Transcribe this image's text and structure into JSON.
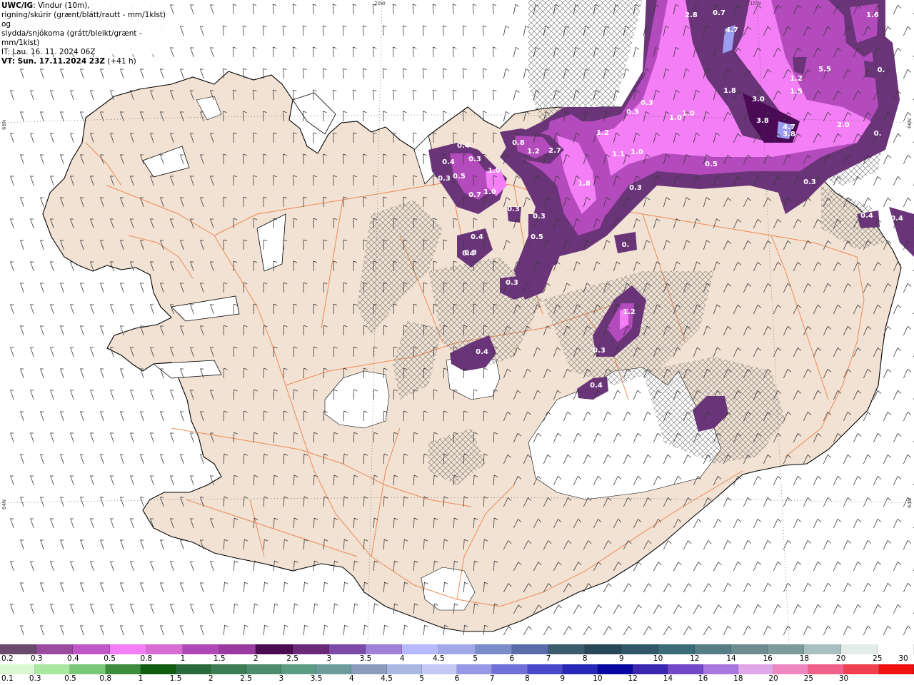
{
  "header": {
    "model": "UWC/IG",
    "line1_rest": ": Vindur (10m),",
    "line2": "rigning/skúrir (grænt/blátt/rautt - mm/1klst) og",
    "line3": "slydda/snjókoma (grátt/bleikt/grænt - mm/1klst)",
    "line4": "IT: Lau. 16. 11. 2024 06Z",
    "line5_bold": "VT: Sun. 17.11.2024 23Z",
    "line5_rest": " (+41 h)"
  },
  "graticule": {
    "top_20w": "20W",
    "top_15w": "15W",
    "left_66n": "66N",
    "right_66n": "66N",
    "left_64n": "64N",
    "right_64n": "64N"
  },
  "map_labels": [
    "0.4",
    "0.4",
    "0.3",
    "0.5",
    "0.3",
    "0.7",
    "1.0",
    "1.0",
    "0.3",
    "0.4",
    "0.4",
    "0.3",
    "0.5",
    "0.3",
    "0.8",
    "1.2",
    "2.7",
    "1.8",
    "1.2",
    "1.1",
    "1.0",
    "0.3",
    "0.3",
    "0.3",
    "1.0",
    "1.0",
    "0.5",
    "2.8",
    "0.7",
    "4.7",
    "1.8",
    "3.0",
    "3.8",
    "3.8",
    "4.7",
    "2.0",
    "0.",
    "1.6",
    "5.5",
    "1.5",
    "1.2",
    "0.",
    "0.4",
    "0.4",
    "0.3",
    "1.2",
    "0.3",
    "0.4",
    "0.4",
    "0.3",
    "0."
  ],
  "colors": {
    "land": "#f1e2d4",
    "sea": "#ffffff",
    "roads": "#ee7b3c",
    "coast": "#000000",
    "snow_dark": "#6a3478",
    "snow_mid": "#b44bbd",
    "snow_light": "#f47ef5",
    "snow_deep": "#4a0a55",
    "snow_blue": "#9c9cf0"
  },
  "legend_snow": {
    "colors": [
      "#6c4a6e",
      "#9c4aa0",
      "#c058c8",
      "#f47ef5",
      "#d76cd5",
      "#b048b8",
      "#9a3aa0",
      "#4c0a50",
      "#6a2a78",
      "#7c4ca8",
      "#a080d8",
      "#b8b8ff",
      "#a0a8e8",
      "#7c8cc8",
      "#5c6ca8",
      "#3c5c6c",
      "#284858",
      "#305868",
      "#3c6c78",
      "#587c84",
      "#6c8c90",
      "#7c9c9c",
      "#a8c0c0",
      "#e4ecea",
      "#ffffff"
    ],
    "labels": [
      "0.2",
      "0.3",
      "0.4",
      "0.5",
      "0.8",
      "1",
      "1.5",
      "2",
      "2.5",
      "3",
      "3.5",
      "4",
      "4.5",
      "5",
      "6",
      "7",
      "8",
      "9",
      "10",
      "12",
      "14",
      "16",
      "18",
      "20",
      "25",
      "30"
    ]
  },
  "legend_rain": {
    "colors": [
      "#d8f8d0",
      "#a8e8a0",
      "#78c878",
      "#3c8c3c",
      "#105c10",
      "#2a6a3a",
      "#3c7c54",
      "#4c8c6c",
      "#5c9c84",
      "#6c9c9c",
      "#8c9cbc",
      "#a8b8e0",
      "#c4c8f4",
      "#9898e8",
      "#7070d8",
      "#4848c8",
      "#2828b8",
      "#0808a0",
      "#3c28b0",
      "#7048c8",
      "#a878e0",
      "#e0a8e8",
      "#f088c0",
      "#f06088",
      "#f04050",
      "#f01010"
    ],
    "labels": [
      "0.1",
      "0.3",
      "0.5",
      "0.8",
      "1",
      "1.5",
      "2",
      "2.5",
      "3",
      "3.5",
      "4",
      "4.5",
      "5",
      "6",
      "7",
      "8",
      "9",
      "10",
      "12",
      "14",
      "16",
      "18",
      "20",
      "25",
      "30"
    ]
  }
}
